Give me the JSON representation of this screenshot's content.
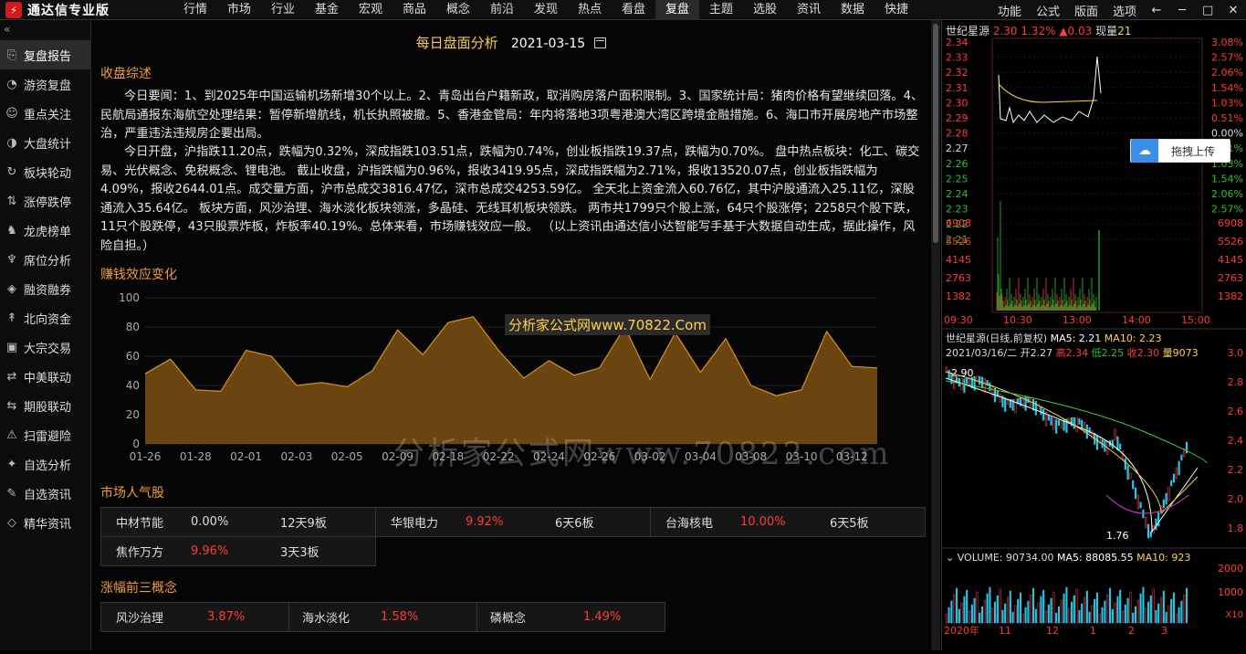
{
  "app": {
    "title": "通达信专业版"
  },
  "menu": [
    "行情",
    "市场",
    "行业",
    "基金",
    "宏观",
    "商品",
    "概念",
    "前沿",
    "发现",
    "热点",
    "看盘",
    "复盘",
    "主题",
    "选股",
    "资讯",
    "数据",
    "快捷"
  ],
  "menu_active": "复盘",
  "menu_right": {
    "func": "功能",
    "formula": "公式",
    "layout": "版面",
    "options": "选项"
  },
  "sidebar": {
    "collapse": "«",
    "items": [
      {
        "label": "复盘报告",
        "icon": "report-icon"
      },
      {
        "label": "游资复盘",
        "icon": "clock-icon"
      },
      {
        "label": "重点关注",
        "icon": "user-icon"
      },
      {
        "label": "大盘统计",
        "icon": "pie-icon"
      },
      {
        "label": "板块轮动",
        "icon": "rotate-icon"
      },
      {
        "label": "涨停跌停",
        "icon": "limit-icon"
      },
      {
        "label": "龙虎榜单",
        "icon": "dragon-icon"
      },
      {
        "label": "席位分析",
        "icon": "trophy-icon"
      },
      {
        "label": "融资融券",
        "icon": "finance-icon"
      },
      {
        "label": "北向资金",
        "icon": "north-icon"
      },
      {
        "label": "大宗交易",
        "icon": "block-icon"
      },
      {
        "label": "中美联动",
        "icon": "link-icon"
      },
      {
        "label": "期股联动",
        "icon": "link2-icon"
      },
      {
        "label": "扫雷避险",
        "icon": "warning-icon"
      },
      {
        "label": "自选分析",
        "icon": "star-icon"
      },
      {
        "label": "自选资讯",
        "icon": "news-icon"
      },
      {
        "label": "精华资讯",
        "icon": "diamond-icon"
      }
    ]
  },
  "main": {
    "title": "每日盘面分析",
    "date": "2021-03-15",
    "summary_title": "收盘综述",
    "para1": "今日要闻：1、到2025年中国运输机场新增30个以上。2、青岛出台户籍新政，取消购房落户面积限制。3、国家统计局：猪肉价格有望继续回落。4、民航局通报东海航空处理结果：暂停新增航线，机长执照被撤。5、香港金管局：年内将落地3项粤港澳大湾区跨境金融措施。6、海口市开展房地产市场整治，严重违法违规房企要出局。",
    "para2": "今日开盘，沪指跌11.20点，跌幅为0.32%，深成指跌103.51点，跌幅为0.74%，创业板指跌19.37点，跌幅为0.70%。 盘中热点板块：化工、碳交易、光伏概念、免税概念、锂电池。 截止收盘，沪指跌幅为0.96%，报收3419.95点，深成指跌幅为2.71%，报收13520.07点，创业板指跌幅为4.09%，报收2644.01点。成交量方面，沪市总成交3816.47亿，深市总成交4253.59亿。 全天北上资金流入60.76亿，其中沪股通流入25.11亿，深股通流入35.64亿。 板块方面，风沙治理、海水淡化板块领涨，多晶硅、无线耳机板块领跌。 两市共1799只个股上涨，64只个股涨停；2258只个股下跌，11只个股跌停，43只股票炸板，炸板率40.19%。总体来看，市场赚钱效应一般。 （以上资讯由通达信小达智能写手基于大数据自动生成，据此操作，风险自担。）",
    "effect_title": "赚钱效应变化",
    "chart_watermark": "分析家公式网www.70822.Com",
    "big_watermark": "分析家公式网www.70822.com",
    "popular_title": "市场人气股",
    "popular": [
      [
        {
          "name": "中材节能",
          "pct": "0.00%",
          "extra": "12天9板",
          "color": "white"
        },
        {
          "name": "华银电力",
          "pct": "9.92%",
          "extra": "6天6板",
          "color": "red"
        },
        {
          "name": "台海核电",
          "pct": "10.00%",
          "extra": "6天5板",
          "color": "red"
        }
      ],
      [
        {
          "name": "焦作万方",
          "pct": "9.96%",
          "extra": "3天3板",
          "color": "red"
        }
      ]
    ],
    "concept_title": "涨幅前三概念",
    "concepts": [
      {
        "name": "风沙治理",
        "pct": "3.87%"
      },
      {
        "name": "海水淡化",
        "pct": "1.58%"
      },
      {
        "name": "磷概念",
        "pct": "1.49%"
      }
    ]
  },
  "chart_data": {
    "type": "area",
    "title": "赚钱效应变化",
    "x": [
      "01-26",
      "01-27",
      "01-28",
      "01-29",
      "02-01",
      "02-02",
      "02-03",
      "02-04",
      "02-05",
      "02-08",
      "02-09",
      "02-10",
      "02-18",
      "02-19",
      "02-22",
      "02-23",
      "02-24",
      "02-25",
      "02-26",
      "03-01",
      "03-02",
      "03-03",
      "03-04",
      "03-05",
      "03-08",
      "03-09",
      "03-10",
      "03-11",
      "03-12",
      "03-15"
    ],
    "x_tick_labels": [
      "01-26",
      "01-28",
      "02-01",
      "02-03",
      "02-05",
      "02-09",
      "02-18",
      "02-22",
      "02-24",
      "02-26",
      "03-02",
      "03-04",
      "03-08",
      "03-10",
      "03-12"
    ],
    "values": [
      48,
      58,
      37,
      36,
      64,
      60,
      40,
      42,
      39,
      50,
      78,
      61,
      83,
      87,
      64,
      45,
      57,
      47,
      52,
      80,
      44,
      76,
      49,
      72,
      40,
      33,
      37,
      77,
      53,
      52
    ],
    "ylim": [
      0,
      100
    ],
    "yticks": [
      0,
      20,
      40,
      60,
      80,
      100
    ],
    "color": "#d9931f"
  },
  "right": {
    "intraday": {
      "name": "世纪星源",
      "price": "2.30",
      "pct": "1.32%",
      "change": "▲0.03",
      "vol_label": "现量",
      "vol": "21",
      "price_ticks": [
        "2.34",
        "2.33",
        "2.32",
        "2.31",
        "2.30",
        "2.29",
        "2.28",
        "2.27",
        "2.26",
        "2.25",
        "2.24",
        "2.23",
        "2.22",
        "2.21"
      ],
      "pct_ticks": [
        "3.08%",
        "2.57%",
        "2.06%",
        "1.54%",
        "1.03%",
        "0.51%",
        "0.00%",
        "0.51%",
        "1.03%",
        "1.54%",
        "2.06%",
        "2.57%"
      ],
      "vol_ticks": [
        "6908",
        "5526",
        "4145",
        "2763",
        "1382"
      ],
      "times": [
        "09:30",
        "10:30",
        "13:00",
        "14:00",
        "15:00"
      ],
      "upload": "拖拽上传"
    },
    "kline": {
      "title": "世纪星源(日线,前复权)",
      "ma5": "MA5: 2.21",
      "ma10": "MA10: 2.23",
      "info_date": "2021/03/16/二",
      "open": "开2.27",
      "high": "高2.34",
      "low": "低2.25",
      "close": "收2.30",
      "vol": "量9073",
      "hi_mark": "2.90",
      "lo_mark": "1.76",
      "ticks": [
        "3.0",
        "2.8",
        "2.6",
        "2.4",
        "2.2",
        "2.0",
        "1.8"
      ]
    },
    "volume": {
      "label": "VOLUME: 90734.00",
      "ma5": "MA5: 88085.55",
      "ma10": "MA10: 923",
      "ticks": [
        "2000",
        "1000"
      ],
      "unit": "X10",
      "months": [
        "2020年",
        "11",
        "12",
        "1",
        "2",
        "3"
      ]
    }
  }
}
